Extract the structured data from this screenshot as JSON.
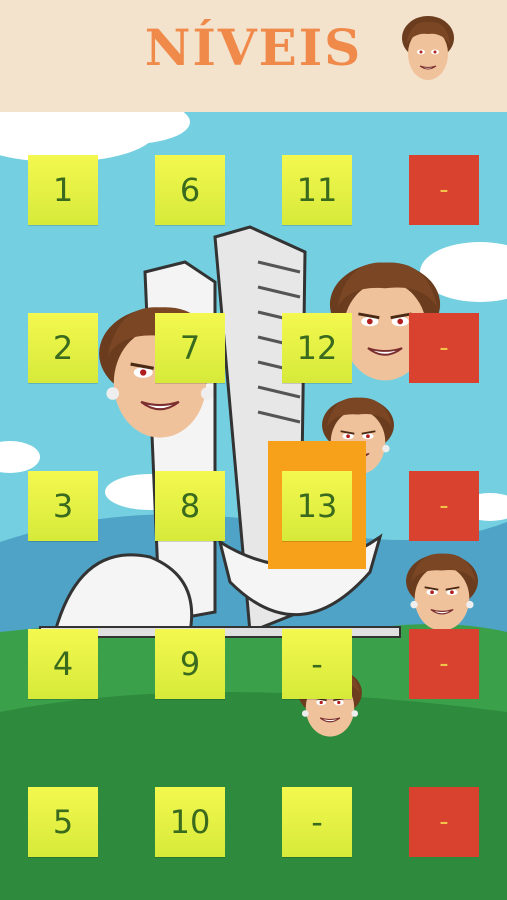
{
  "header": {
    "title": "NÍVEIS",
    "avatar_icon": "caricature-face-icon"
  },
  "selected_level": "13",
  "levels": [
    {
      "label": "1",
      "state": "open"
    },
    {
      "label": "6",
      "state": "open"
    },
    {
      "label": "11",
      "state": "open"
    },
    {
      "label": "-",
      "state": "locked"
    },
    {
      "label": "2",
      "state": "open"
    },
    {
      "label": "7",
      "state": "open"
    },
    {
      "label": "12",
      "state": "open"
    },
    {
      "label": "-",
      "state": "locked"
    },
    {
      "label": "3",
      "state": "open"
    },
    {
      "label": "8",
      "state": "open"
    },
    {
      "label": "13",
      "state": "open",
      "selected": true
    },
    {
      "label": "-",
      "state": "locked"
    },
    {
      "label": "4",
      "state": "open"
    },
    {
      "label": "9",
      "state": "open"
    },
    {
      "label": "-",
      "state": "open"
    },
    {
      "label": "-",
      "state": "locked"
    },
    {
      "label": "5",
      "state": "open"
    },
    {
      "label": "10",
      "state": "open"
    },
    {
      "label": "-",
      "state": "open"
    },
    {
      "label": "-",
      "state": "locked"
    }
  ],
  "colors": {
    "header_bg": "#f3e2cc",
    "title": "#f08a4b",
    "sky": "#74d0e0",
    "grass": "#3aa04a",
    "tile_open": "#e8f242",
    "tile_locked": "#d8422e",
    "selection": "#f7a11b"
  }
}
